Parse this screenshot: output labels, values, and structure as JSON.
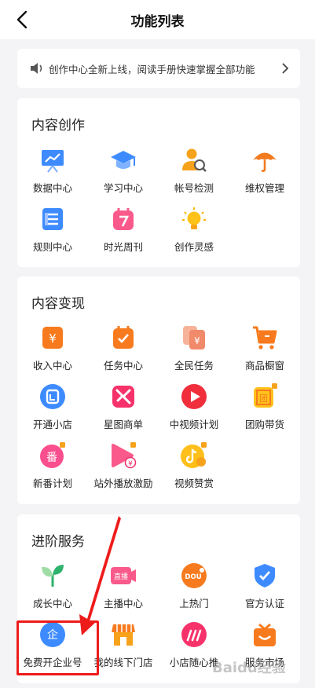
{
  "header": {
    "title": "功能列表"
  },
  "notice": {
    "text": "创作中心全新上线，阅读手册快速掌握全部功能"
  },
  "sections": [
    {
      "title": "内容创作",
      "items": [
        {
          "label": "数据中心",
          "icon": "chart-board-icon"
        },
        {
          "label": "学习中心",
          "icon": "graduation-cap-icon"
        },
        {
          "label": "帐号检测",
          "icon": "user-check-icon"
        },
        {
          "label": "维权管理",
          "icon": "umbrella-icon"
        },
        {
          "label": "规则中心",
          "icon": "rulebook-icon"
        },
        {
          "label": "时光周刊",
          "icon": "calendar-7-icon"
        },
        {
          "label": "创作灵感",
          "icon": "lightbulb-icon"
        }
      ]
    },
    {
      "title": "内容变现",
      "items": [
        {
          "label": "收入中心",
          "icon": "yen-icon"
        },
        {
          "label": "任务中心",
          "icon": "task-icon"
        },
        {
          "label": "全民任务",
          "icon": "yen-cards-icon"
        },
        {
          "label": "商品橱窗",
          "icon": "cart-icon"
        },
        {
          "label": "开通小店",
          "icon": "shop-bag-icon"
        },
        {
          "label": "星图商单",
          "icon": "star-map-icon"
        },
        {
          "label": "中视频计划",
          "icon": "play-icon"
        },
        {
          "label": "团购带货",
          "icon": "group-buy-icon"
        },
        {
          "label": "新番计划",
          "icon": "fan-icon"
        },
        {
          "label": "站外播放激励",
          "icon": "play-yen-icon"
        },
        {
          "label": "视频赞赏",
          "icon": "tiktok-coin-icon"
        }
      ]
    },
    {
      "title": "进阶服务",
      "items": [
        {
          "label": "成长中心",
          "icon": "sprout-icon"
        },
        {
          "label": "主播中心",
          "icon": "live-icon"
        },
        {
          "label": "上热门",
          "icon": "dou-plus-icon"
        },
        {
          "label": "官方认证",
          "icon": "verified-shield-icon"
        },
        {
          "label": "免费开企业号",
          "icon": "enterprise-icon"
        },
        {
          "label": "我的线下门店",
          "icon": "storefront-icon"
        },
        {
          "label": "小店随心推",
          "icon": "boost-icon"
        },
        {
          "label": "服务市场",
          "icon": "service-market-icon"
        }
      ]
    }
  ],
  "watermark": "Baidu经验",
  "colors": {
    "annotation_red": "#ee1b1b",
    "accent_orange": "#f27a1f",
    "accent_blue": "#3f8cff"
  }
}
